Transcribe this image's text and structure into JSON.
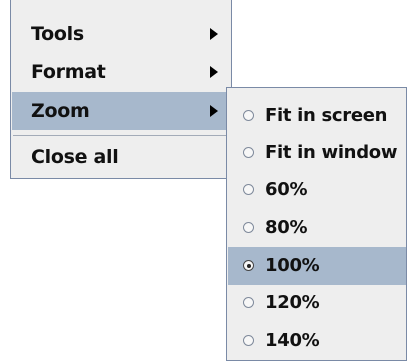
{
  "menu": {
    "items": [
      {
        "label": "Tools"
      },
      {
        "label": "Format"
      },
      {
        "label": "Zoom"
      },
      {
        "label": "Close all"
      }
    ]
  },
  "zoom_submenu": {
    "options": [
      {
        "label": "Fit in screen"
      },
      {
        "label": "Fit in window"
      },
      {
        "label": "60%"
      },
      {
        "label": "80%"
      },
      {
        "label": "100%"
      },
      {
        "label": "120%"
      },
      {
        "label": "140%"
      }
    ],
    "selected": "100%"
  }
}
